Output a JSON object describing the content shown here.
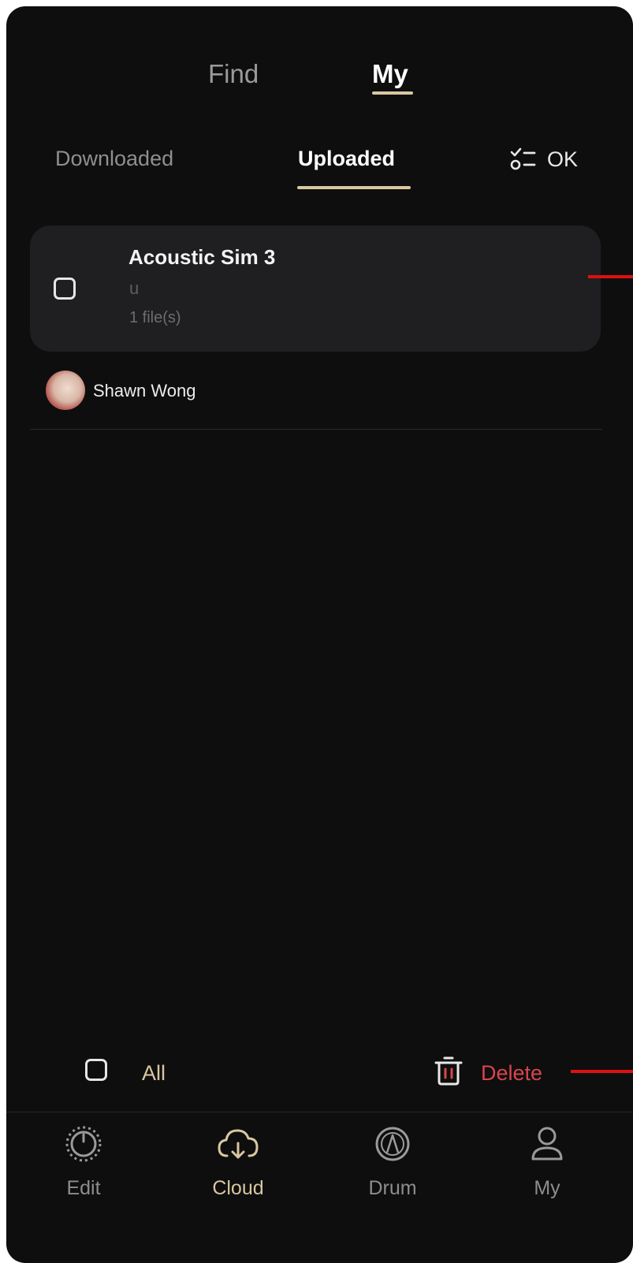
{
  "top_tabs": {
    "find": "Find",
    "my": "My"
  },
  "sub_tabs": {
    "downloaded": "Downloaded",
    "uploaded": "Uploaded",
    "ok": "OK"
  },
  "items": [
    {
      "title": "Acoustic Sim 3",
      "subtitle": "u",
      "files": "1 file(s)",
      "selected": false
    }
  ],
  "author": {
    "name": "Shawn Wong"
  },
  "actions": {
    "all_label": "All",
    "delete_label": "Delete"
  },
  "bottom_nav": {
    "edit": "Edit",
    "cloud": "Cloud",
    "drum": "Drum",
    "my": "My"
  },
  "colors": {
    "background": "#0e0e0e",
    "accent": "#d8c7a0",
    "delete": "#d9454c",
    "card": "#1f1f21",
    "annotation": "#e00f10"
  }
}
